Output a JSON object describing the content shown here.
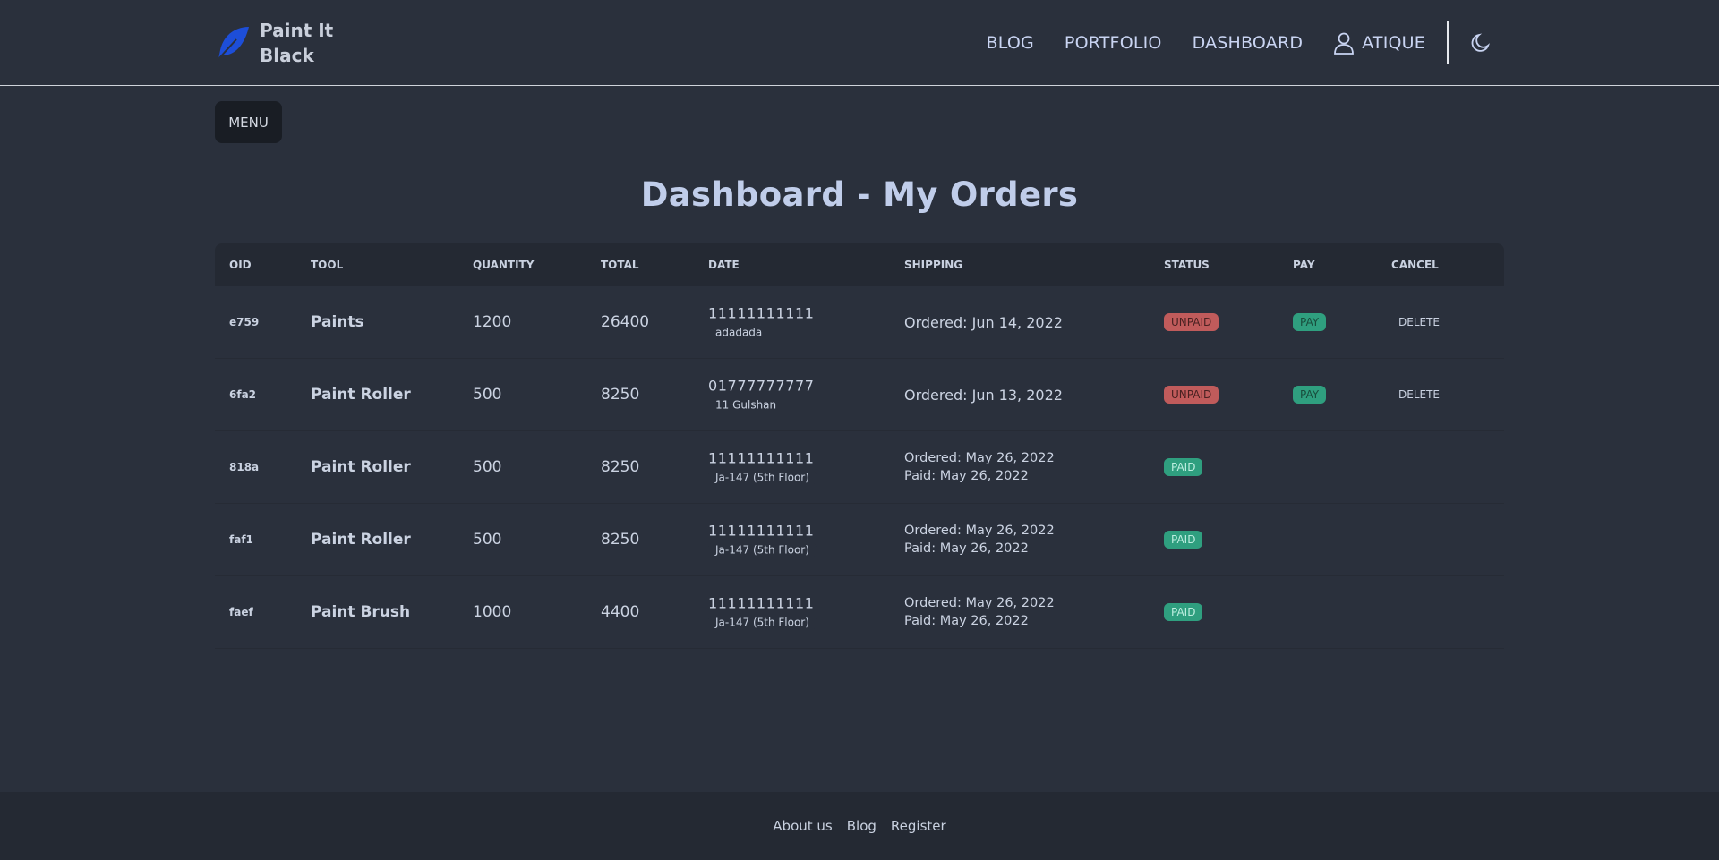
{
  "brand": {
    "name": "Paint It Black",
    "logo_icon": "feather-icon",
    "logo_color": "#1d4ed8"
  },
  "nav": {
    "links": [
      "BLOG",
      "PORTFOLIO",
      "DASHBOARD"
    ],
    "user": "ATIQUE",
    "theme_icon": "moon-icon"
  },
  "menu_label": "MENU",
  "title": "Dashboard - My Orders",
  "table": {
    "headers": [
      "OID",
      "TOOL",
      "QUANTITY",
      "TOTAL",
      "DATE",
      "SHIPPING",
      "STATUS",
      "PAY",
      "CANCEL"
    ],
    "rows": [
      {
        "oid": "e759",
        "tool": "Paints",
        "quantity": "1200",
        "total": "26400",
        "phone": "11111111111",
        "address": "adadada",
        "ship_line1": "Ordered: Jun 14, 2022",
        "ship_line2": "",
        "status": "UNPAID",
        "pay": "PAY",
        "cancel": "DELETE"
      },
      {
        "oid": "6fa2",
        "tool": "Paint Roller",
        "quantity": "500",
        "total": "8250",
        "phone": "01777777777",
        "address": "11 Gulshan",
        "ship_line1": "Ordered: Jun 13, 2022",
        "ship_line2": "",
        "status": "UNPAID",
        "pay": "PAY",
        "cancel": "DELETE"
      },
      {
        "oid": "818a",
        "tool": "Paint Roller",
        "quantity": "500",
        "total": "8250",
        "phone": "11111111111",
        "address": "Ja-147 (5th Floor)",
        "ship_line1": "Ordered: May 26, 2022",
        "ship_line2": "Paid: May 26, 2022",
        "status": "PAID",
        "pay": "",
        "cancel": ""
      },
      {
        "oid": "faf1",
        "tool": "Paint Roller",
        "quantity": "500",
        "total": "8250",
        "phone": "11111111111",
        "address": "Ja-147 (5th Floor)",
        "ship_line1": "Ordered: May 26, 2022",
        "ship_line2": "Paid: May 26, 2022",
        "status": "PAID",
        "pay": "",
        "cancel": ""
      },
      {
        "oid": "faef",
        "tool": "Paint Brush",
        "quantity": "1000",
        "total": "4400",
        "phone": "11111111111",
        "address": "Ja-147 (5th Floor)",
        "ship_line1": "Ordered: May 26, 2022",
        "ship_line2": "Paid: May 26, 2022",
        "status": "PAID",
        "pay": "",
        "cancel": ""
      }
    ]
  },
  "footer": {
    "links": [
      "About us",
      "Blog",
      "Register"
    ]
  },
  "colors": {
    "background": "#2a303c",
    "unpaid": "#c05b5b",
    "paid": "#2f9f7f"
  }
}
